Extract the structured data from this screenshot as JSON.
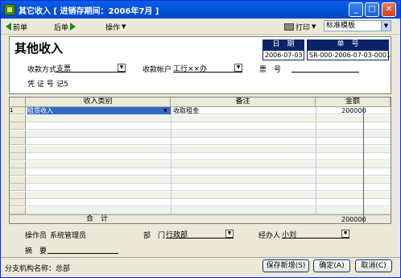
{
  "window": {
    "title": "其它收入 [ 进销存期间：2006年7月 ]",
    "controls": {
      "minimize": "_",
      "maximize": "□",
      "close": "✕"
    }
  },
  "toolbar": {
    "prev": "前单",
    "next": "后单",
    "operate": "操作",
    "print": "打印",
    "template_value": "标准模板"
  },
  "form": {
    "title": "其他收入",
    "payment_method_label": "收款方式",
    "payment_method_value": "支票",
    "receive_account_label": "收款帐户",
    "receive_account_value": "工行××办",
    "ticket_label": "票　号",
    "ticket_value": "",
    "voucher_label": "凭 证 号",
    "voucher_value": "记5",
    "date_label": "日　期",
    "date_value": "2006-07-03",
    "doc_no_label": "单　号",
    "doc_no_value": "SR-000-2006-07-03-0001"
  },
  "grid": {
    "columns": {
      "category": "收入类别",
      "remark": "备注",
      "amount": "金额"
    },
    "rows": [
      {
        "num": "1",
        "category": "租赁收入",
        "remark": "收取租金",
        "amount": "200000"
      }
    ],
    "total_label": "合　计",
    "total_value": "200000"
  },
  "footer": {
    "operator_label": "操作员",
    "operator_value": "系统管理员",
    "dept_label": "部　门",
    "dept_value": "行政部",
    "handler_label": "经办人",
    "handler_value": "小刘",
    "summary_label": "摘　要",
    "summary_value": "",
    "branch_label": "分支机构名称：总部",
    "save_new": "保存新增(S)",
    "ok": "确定(A)",
    "cancel": "取消(C)"
  }
}
